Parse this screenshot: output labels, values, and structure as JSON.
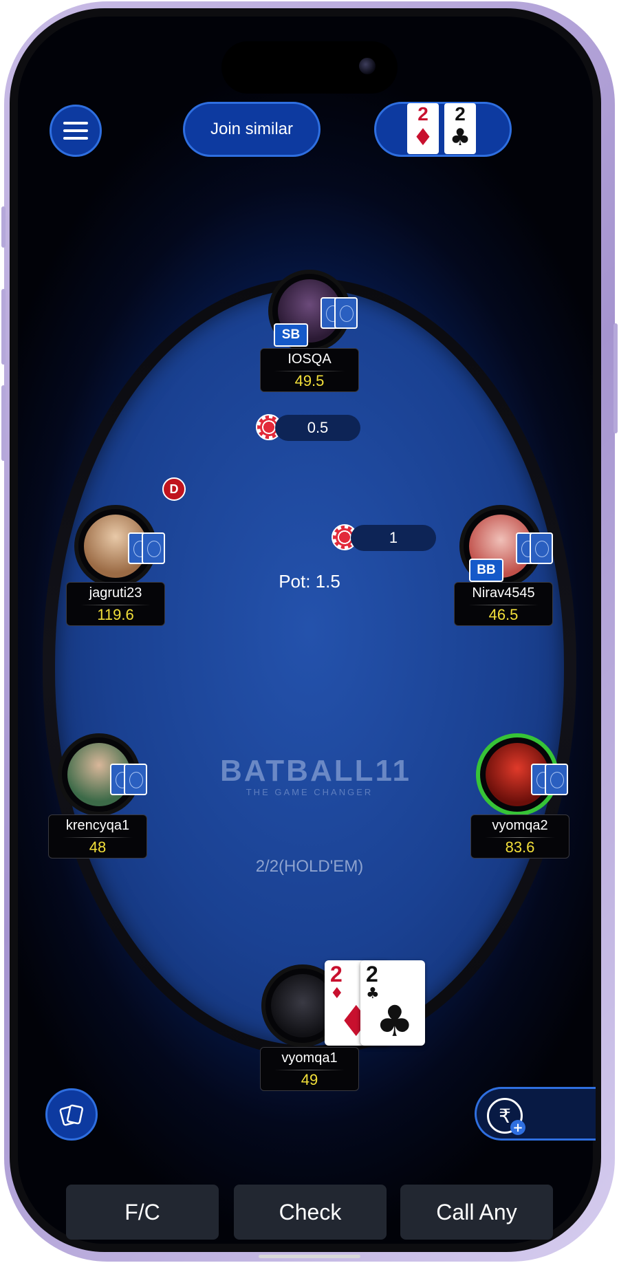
{
  "header": {
    "menu_icon": "hamburger-icon",
    "join_similar_label": "Join similar",
    "hand_cards": [
      {
        "rank": "2",
        "suit": "♦",
        "color": "#c8102e"
      },
      {
        "rank": "2",
        "suit": "♣",
        "color": "#111111"
      }
    ]
  },
  "table": {
    "brand_title": "BATBALL11",
    "brand_tagline": "THE GAME CHANGER",
    "game_info": "2/2(HOLD'EM)",
    "pot_label": "Pot: 1.5",
    "dealer_button": "D"
  },
  "players": [
    {
      "seat": "top",
      "name": "IOSQA",
      "stack": "49.5",
      "badge": "SB",
      "bet": "0.5"
    },
    {
      "seat": "left-upper",
      "name": "jagruti23",
      "stack": "119.6"
    },
    {
      "seat": "right-upper",
      "name": "Nirav4545",
      "stack": "46.5",
      "badge": "BB",
      "bet": "1"
    },
    {
      "seat": "left-lower",
      "name": "krencyqa1",
      "stack": "48"
    },
    {
      "seat": "right-lower",
      "name": "vyomqa2",
      "stack": "83.6",
      "active": true
    },
    {
      "seat": "bottom",
      "name": "vyomqa1",
      "stack": "49",
      "hero": true
    }
  ],
  "hero_cards": [
    {
      "rank": "2",
      "suit": "♦",
      "color": "#c8102e"
    },
    {
      "rank": "2",
      "suit": "♣",
      "color": "#111111"
    }
  ],
  "bottom_bar": {
    "cards_icon": "cards-icon",
    "add_cash_icon": "rupee-add-icon",
    "rupee_symbol": "₹",
    "actions": [
      "F/C",
      "Check",
      "Call Any"
    ]
  },
  "colors": {
    "button_blue": "#0d3aa0",
    "button_border": "#2f6fe0",
    "stack_yellow": "#f3e03a",
    "active_ring": "#37c437"
  }
}
